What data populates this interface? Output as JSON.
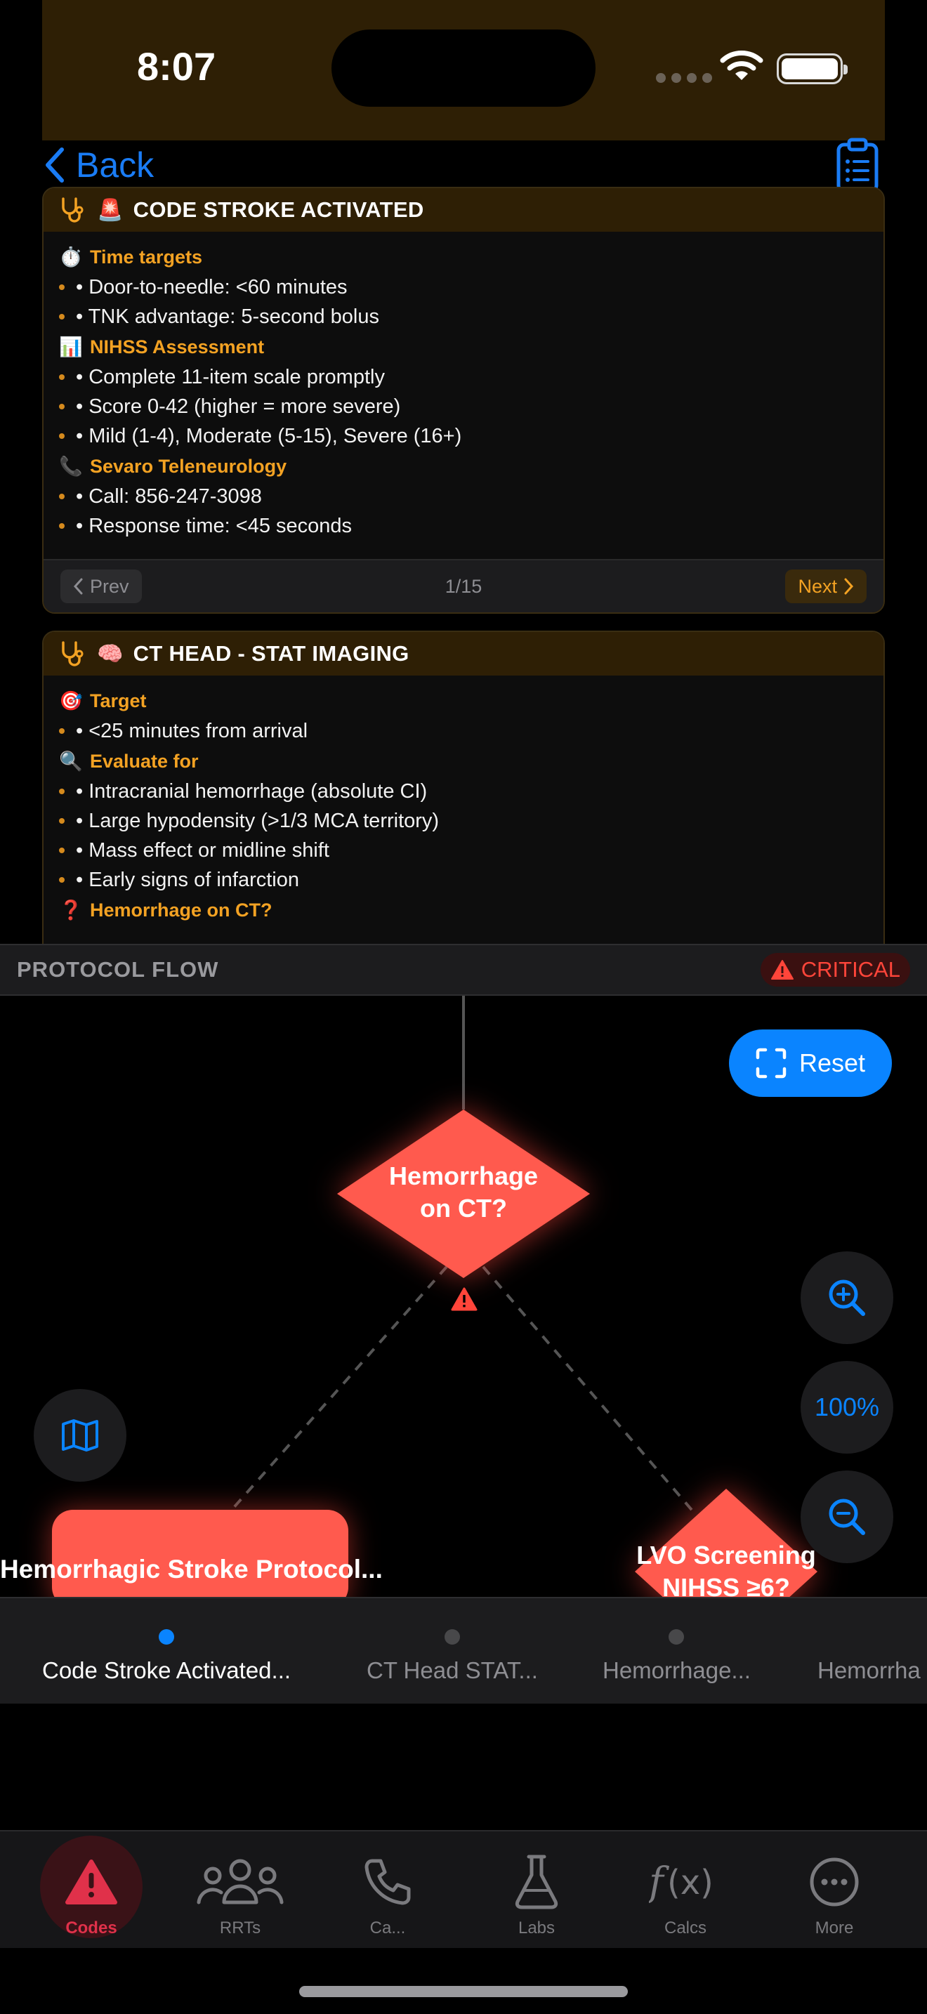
{
  "status_bar": {
    "time": "8:07"
  },
  "nav": {
    "back_label": "Back",
    "clipboard_icon": "list-clipboard-icon"
  },
  "cards": [
    {
      "emoji": "🚨",
      "title": "CODE STROKE ACTIVATED",
      "sections": [
        {
          "emoji": "⏱️",
          "title": "Time targets",
          "bullets": [
            "• Door-to-needle: <60 minutes",
            "• TNK advantage: 5-second bolus"
          ]
        },
        {
          "emoji": "📊",
          "title": "NIHSS Assessment",
          "bullets": [
            "• Complete 11-item scale promptly",
            "• Score 0-42 (higher = more severe)",
            "• Mild (1-4), Moderate (5-15), Severe (16+)"
          ]
        },
        {
          "emoji": "📞",
          "title": "Sevaro Teleneurology",
          "bullets": [
            "• Call: 856-247-3098",
            "• Response time: <45 seconds"
          ]
        }
      ],
      "footer": {
        "prev": "Prev",
        "page": "1/15",
        "next": "Next"
      }
    },
    {
      "emoji": "🧠",
      "title": "CT HEAD - STAT IMAGING",
      "sections": [
        {
          "emoji": "🎯",
          "title": "Target",
          "bullets": [
            "• <25 minutes from arrival"
          ]
        },
        {
          "emoji": "🔍",
          "title": "Evaluate for",
          "bullets": [
            "• Intracranial hemorrhage (absolute CI)",
            "• Large hypodensity (>1/3 MCA territory)",
            "• Mass effect or midline shift",
            "• Early signs of infarction"
          ]
        },
        {
          "emoji": "❓",
          "title": "Hemorrhage on CT?",
          "bullets": []
        }
      ]
    }
  ],
  "flow": {
    "title": "PROTOCOL FLOW",
    "badge": "CRITICAL",
    "reset_label": "Reset",
    "zoom_level": "100%",
    "nodes": {
      "decision_1": [
        "Hemorrhage",
        "on CT?"
      ],
      "hemorrhagic": "Hemorrhagic Stroke Protocol...",
      "decision_2": [
        "LVO Screening",
        "NIHSS ≥6?"
      ]
    },
    "colors": {
      "node": "#ff5a4e",
      "accent": "#0a84ff",
      "critical": "#ff453a"
    }
  },
  "steps": [
    {
      "label": "Code Stroke Activated...",
      "active": true
    },
    {
      "label": "CT Head STAT...",
      "active": false
    },
    {
      "label": "Hemorrhage...",
      "active": false
    },
    {
      "label": "Hemorrha",
      "active": false
    }
  ],
  "tabs": [
    {
      "label": "Codes",
      "icon": "warning-icon",
      "active": true
    },
    {
      "label": "RRTs",
      "icon": "people-icon",
      "active": false
    },
    {
      "label": "Ca...",
      "icon": "phone-icon",
      "active": false
    },
    {
      "label": "Labs",
      "icon": "flask-icon",
      "active": false
    },
    {
      "label": "Calcs",
      "icon": "function-icon",
      "active": false
    },
    {
      "label": "More",
      "icon": "more-icon",
      "active": false
    }
  ]
}
